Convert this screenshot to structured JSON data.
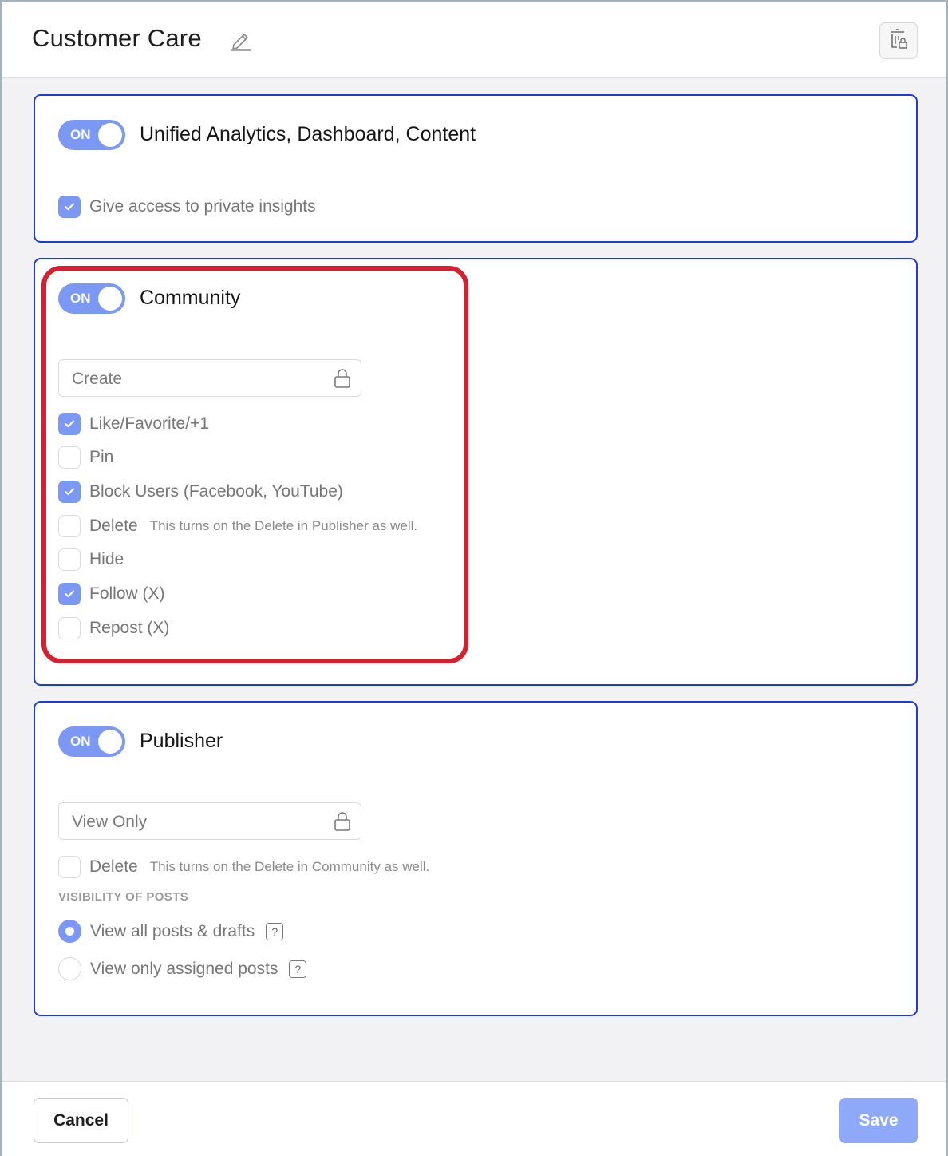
{
  "header": {
    "title": "Customer Care"
  },
  "sections": {
    "analytics": {
      "toggle_label": "ON",
      "title": "Unified Analytics, Dashboard, Content",
      "checkbox": {
        "label": "Give access to private insights",
        "checked": true
      }
    },
    "community": {
      "toggle_label": "ON",
      "title": "Community",
      "select": {
        "value": "Create"
      },
      "options": [
        {
          "label": "Like/Favorite/+1",
          "checked": true,
          "hint": ""
        },
        {
          "label": "Pin",
          "checked": false,
          "hint": ""
        },
        {
          "label": "Block Users (Facebook, YouTube)",
          "checked": true,
          "hint": ""
        },
        {
          "label": "Delete",
          "checked": false,
          "hint": "This turns on the Delete in Publisher as well."
        },
        {
          "label": "Hide",
          "checked": false,
          "hint": ""
        },
        {
          "label": "Follow (X)",
          "checked": true,
          "hint": ""
        },
        {
          "label": "Repost (X)",
          "checked": false,
          "hint": ""
        }
      ]
    },
    "publisher": {
      "toggle_label": "ON",
      "title": "Publisher",
      "select": {
        "value": "View Only"
      },
      "delete": {
        "label": "Delete",
        "checked": false,
        "hint": "This turns on the Delete in Community as well."
      },
      "visibility_heading": "VISIBILITY OF POSTS",
      "visibility_options": [
        {
          "label": "View all posts & drafts",
          "selected": true,
          "help": "?"
        },
        {
          "label": "View only assigned posts",
          "selected": false,
          "help": "?"
        }
      ]
    }
  },
  "footer": {
    "cancel_label": "Cancel",
    "save_label": "Save"
  },
  "colors": {
    "accent": "#7b98f4",
    "card_border": "#1f3ad6",
    "highlight": "#d5212f",
    "save_button": "#8ea9f7"
  },
  "icons": {
    "edit": "pencil-icon",
    "role": "role-permissions-icon",
    "lock": "lock-icon",
    "check": "check-icon",
    "help": "help-icon"
  }
}
